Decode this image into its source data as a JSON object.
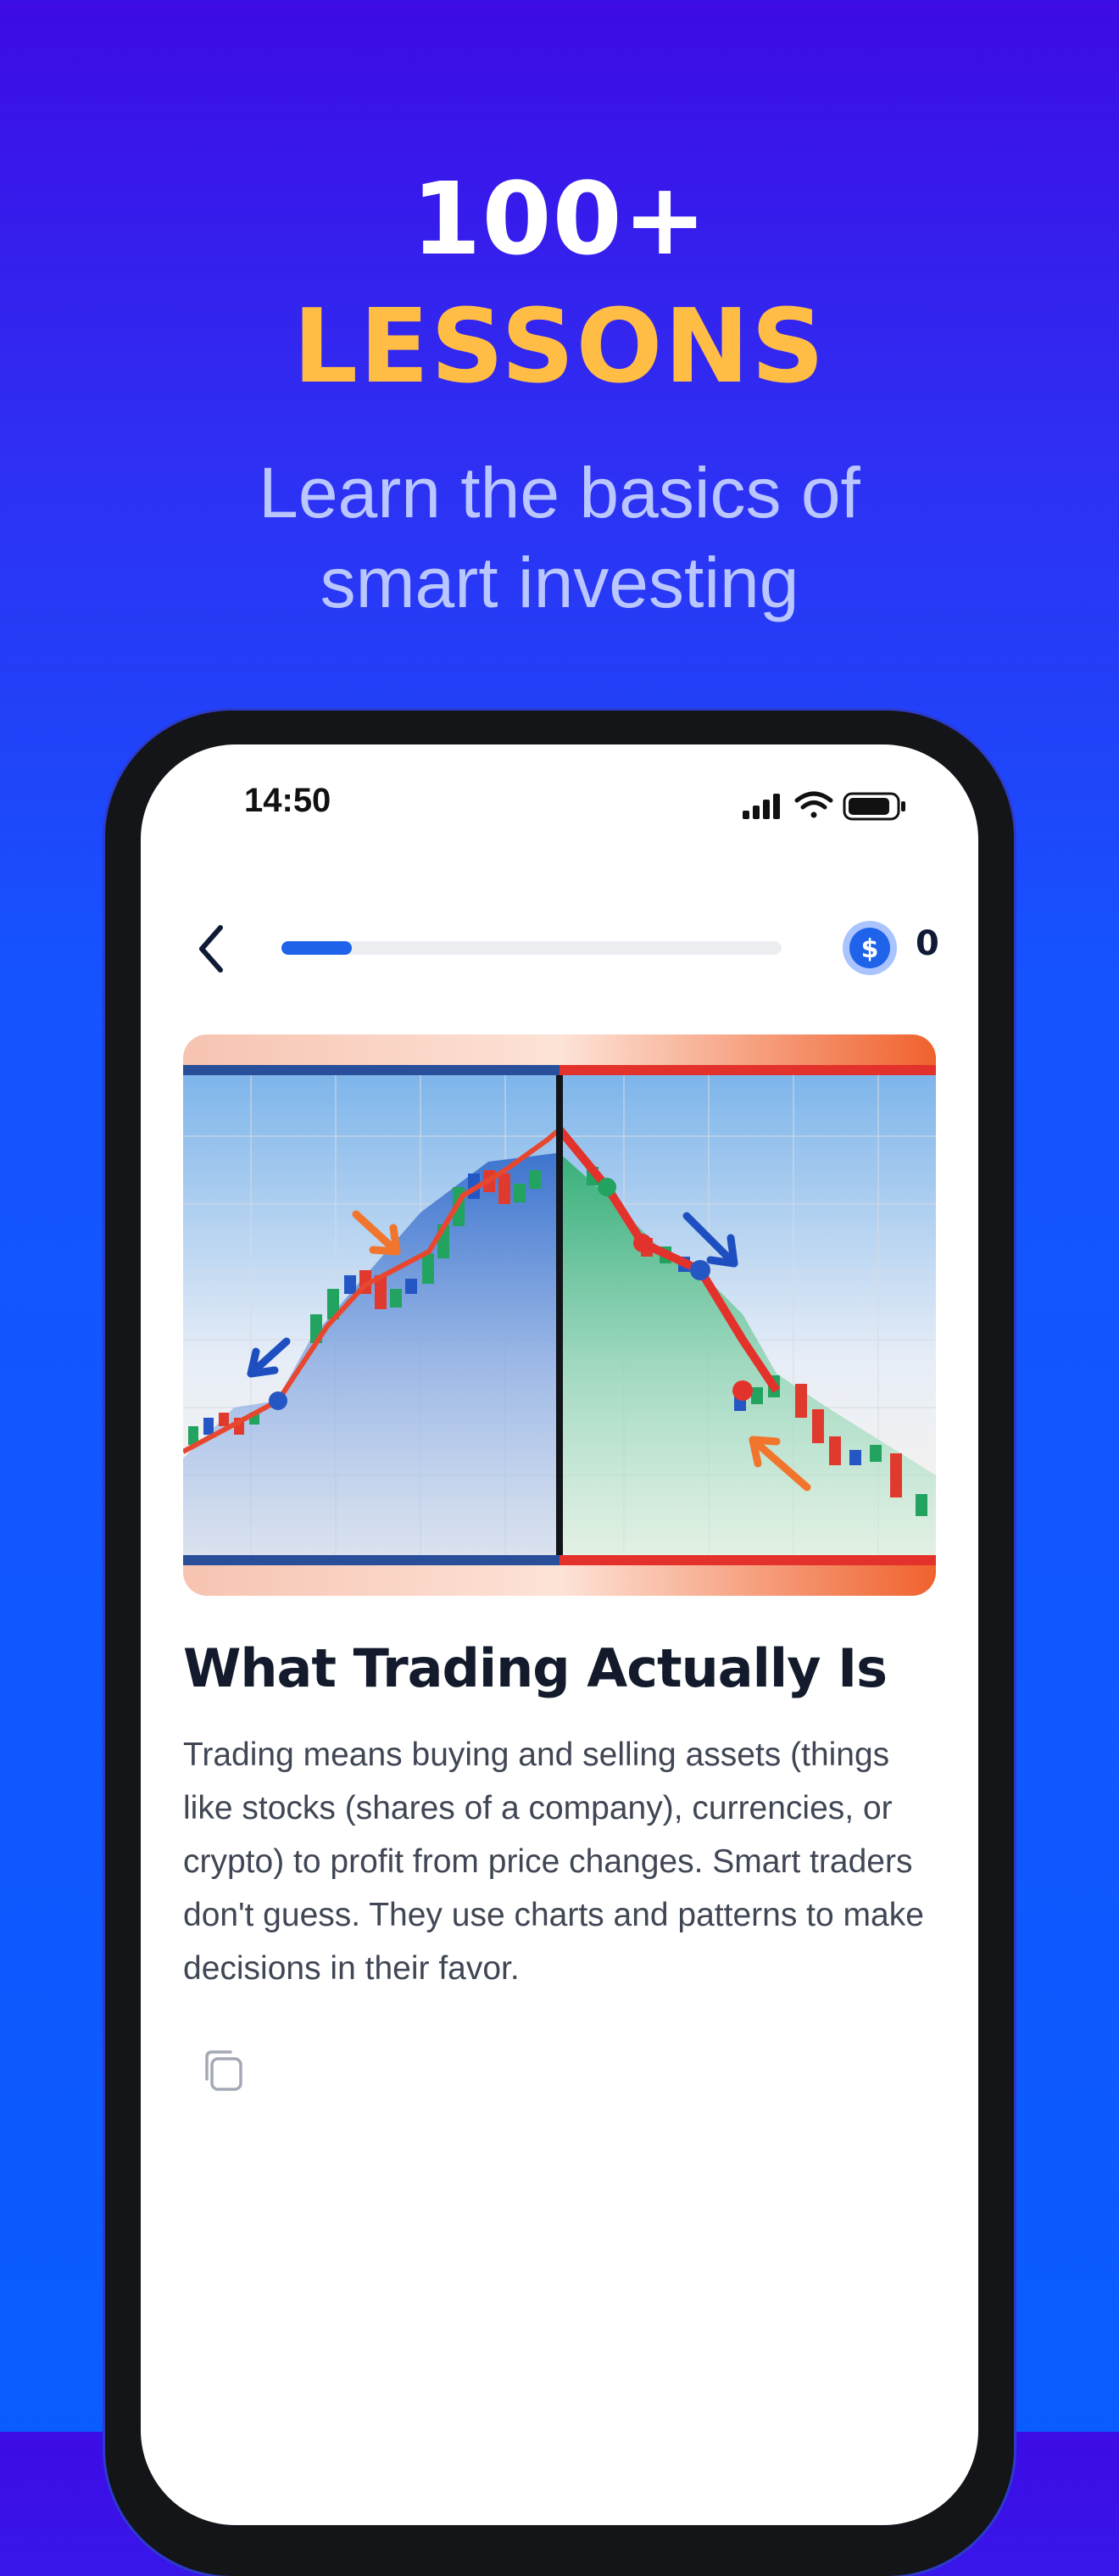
{
  "hero": {
    "count": "100+",
    "word": "LESSONS",
    "subtitle_line1": "Learn the basics of",
    "subtitle_line2": "smart investing"
  },
  "status_bar": {
    "time": "14:50",
    "icons": [
      "cellular-signal-icon",
      "wifi-icon",
      "battery-icon"
    ]
  },
  "lesson_header": {
    "back_icon": "chevron-left-icon",
    "progress": 0.14,
    "coin_icon": "dollar-coin-icon",
    "coins": "0"
  },
  "lesson": {
    "illustration": "candlestick chart illustration showing a rising trend then a falling trend",
    "title": "What Trading Actually Is",
    "body": "Trading means buying and selling assets (things like stocks (shares of a company), currencies, or crypto) to profit from price changes. Smart traders don't guess. They use charts and patterns to make decisions in their favor.",
    "copy_icon": "copy-icon"
  },
  "colors": {
    "accent": "#1e63e9",
    "hero_highlight": "#ffbd45",
    "background_top": "#3d0be6",
    "background_bottom": "#0b5cff"
  }
}
